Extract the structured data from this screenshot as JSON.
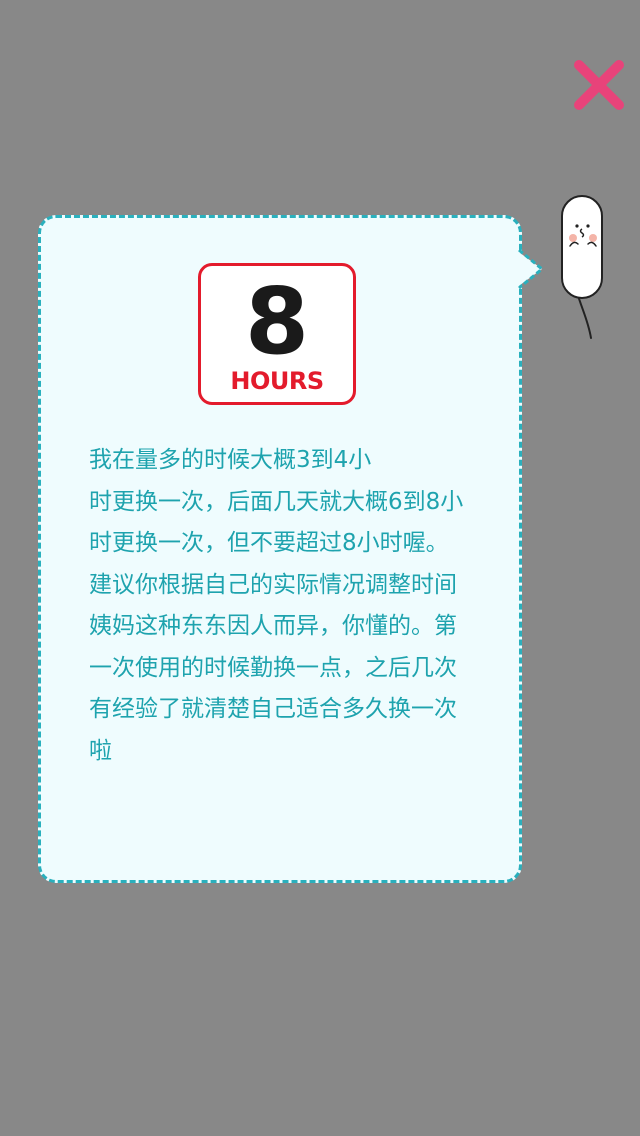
{
  "dialog": {
    "close_icon": "close-x-icon",
    "close_color": "#e8437a",
    "badge": {
      "number": "8",
      "unit": "HOURS",
      "number_color": "#1a1a1a",
      "unit_color": "#e31b2c"
    },
    "tip_lines": [
      "我在量多的时候大概3到4小",
      "时更换一次，后面几天就大概6到8小",
      "时更换一次，但不要超过8小时喔。",
      "建议你根据自己的实际情况调整时间",
      "姨妈这种东东因人而异，你懂的。第",
      "一次使用的时候勤换一点，之后几次",
      "有经验了就清楚自己适合多久换一次",
      "啦"
    ],
    "text_color": "#1ea3ae",
    "bubble_color": "#effcfe",
    "border_color": "#2ab0bd",
    "mascot": "tampon-mascot-icon"
  }
}
